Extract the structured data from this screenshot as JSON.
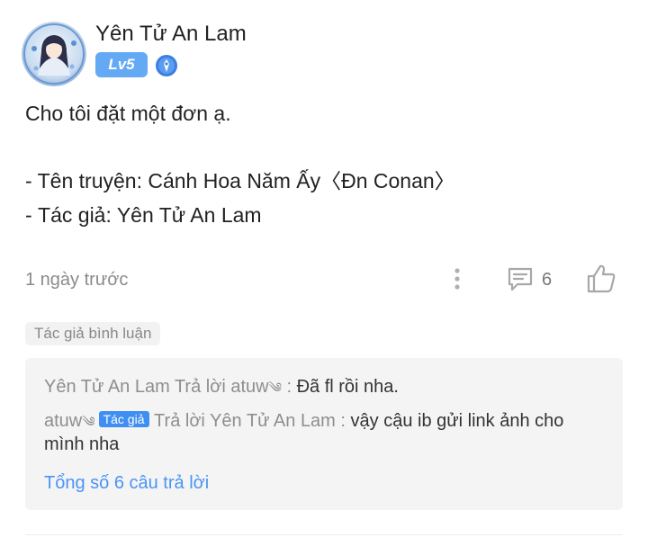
{
  "post": {
    "username": "Yên Tử An Lam",
    "level": "Lv5",
    "content": "Cho tôi đặt một đơn ạ.\n\n- Tên truyện: Cánh Hoa Năm Ấy〈Đn Conan〉\n- Tác giả: Yên Tử An Lam",
    "time": "1 ngày trước",
    "comment_count": "6"
  },
  "author_comment_tag": "Tác giả bình luận",
  "replies": [
    {
      "name": "Yên Tử An Lam",
      "action": " Trả lời ",
      "target": "atuw",
      "sign": "༄",
      "separator": " : ",
      "text": "Đã fl rồi nha."
    },
    {
      "name": "atuw",
      "sign": "༄",
      "badge": "Tác giả",
      "action": " Trả lời ",
      "target": "Yên Tử An Lam",
      "separator": " : ",
      "text": "vậy cậu ib gửi link ảnh cho mình nha"
    }
  ],
  "total_replies": "Tổng số 6 câu trả lời",
  "icons": {
    "verified": "verified-badge-icon",
    "more": "more-vertical-icon",
    "comment": "comment-icon",
    "like": "thumbs-up-icon"
  },
  "colors": {
    "level_badge": "#64a9f3",
    "author_pill": "#3f8ff2",
    "link": "#4a94f5",
    "reply_bg": "#f4f4f4"
  }
}
